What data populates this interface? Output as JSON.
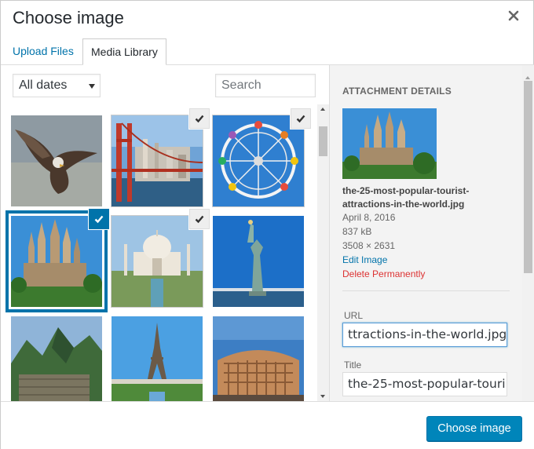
{
  "dialog": {
    "title": "Choose image"
  },
  "tabs": [
    {
      "label": "Upload Files",
      "active": false
    },
    {
      "label": "Media Library",
      "active": true
    }
  ],
  "filters": {
    "date_select": {
      "selected": "All dates"
    },
    "search": {
      "placeholder": "Search",
      "value": ""
    }
  },
  "media_items": [
    {
      "subject": "eagle",
      "checked": false,
      "selected": false
    },
    {
      "subject": "golden-gate-bridge",
      "checked": true,
      "selected": false
    },
    {
      "subject": "ferris-wheel",
      "checked": true,
      "selected": false
    },
    {
      "subject": "sagrada-familia",
      "checked": true,
      "selected": true
    },
    {
      "subject": "taj-mahal",
      "checked": true,
      "selected": false
    },
    {
      "subject": "statue-of-liberty",
      "checked": false,
      "selected": false
    },
    {
      "subject": "machu-picchu",
      "checked": false,
      "selected": false
    },
    {
      "subject": "eiffel-tower",
      "checked": false,
      "selected": false
    },
    {
      "subject": "colosseum",
      "checked": false,
      "selected": false
    }
  ],
  "details": {
    "heading": "ATTACHMENT DETAILS",
    "filename": "the-25-most-popular-tourist-attractions-in-the-world.jpg",
    "date": "April 8, 2016",
    "filesize": "837 kB",
    "dimensions": "3508 × 2631",
    "edit_link": "Edit Image",
    "delete_link": "Delete Permanently",
    "url_label": "URL",
    "url_value": "ttractions-in-the-world.jpg",
    "title_label": "Title",
    "title_value": "the-25-most-popular-touri"
  },
  "footer": {
    "primary_button": "Choose image"
  },
  "colors": {
    "accent": "#0073aa",
    "button": "#0085ba",
    "danger": "#dc3232"
  }
}
